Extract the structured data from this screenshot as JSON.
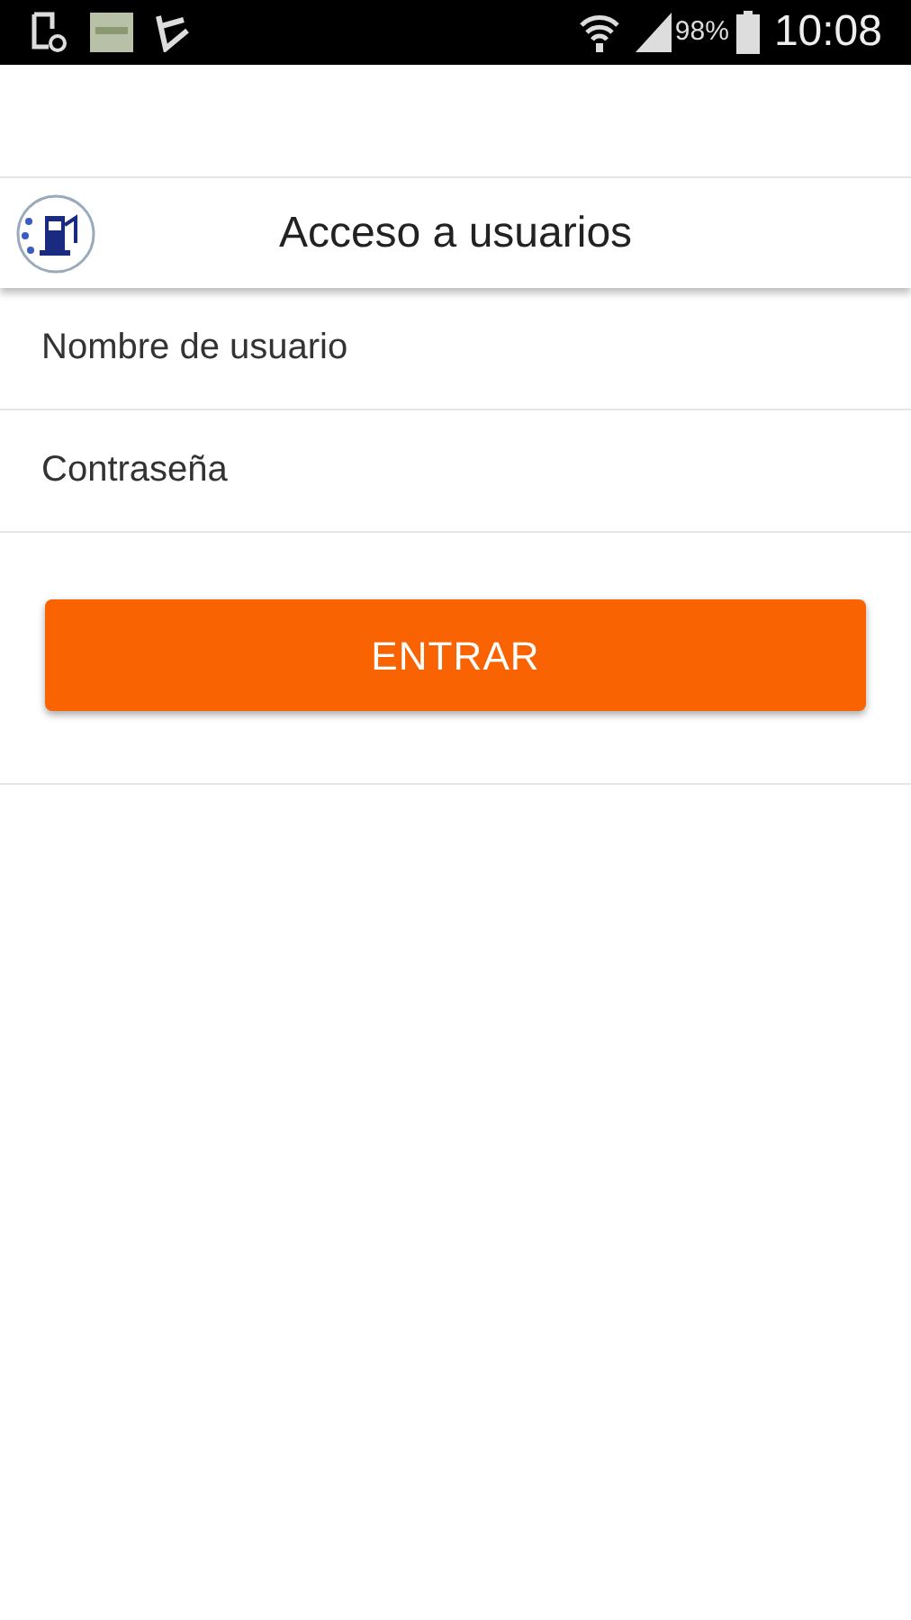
{
  "status_bar": {
    "battery": "98%",
    "time": "10:08"
  },
  "header": {
    "title": "Acceso a usuarios"
  },
  "form": {
    "fields": [
      {
        "placeholder": "Nombre de usuario"
      },
      {
        "placeholder": "Contraseña"
      }
    ],
    "submit": "ENTRAR"
  }
}
